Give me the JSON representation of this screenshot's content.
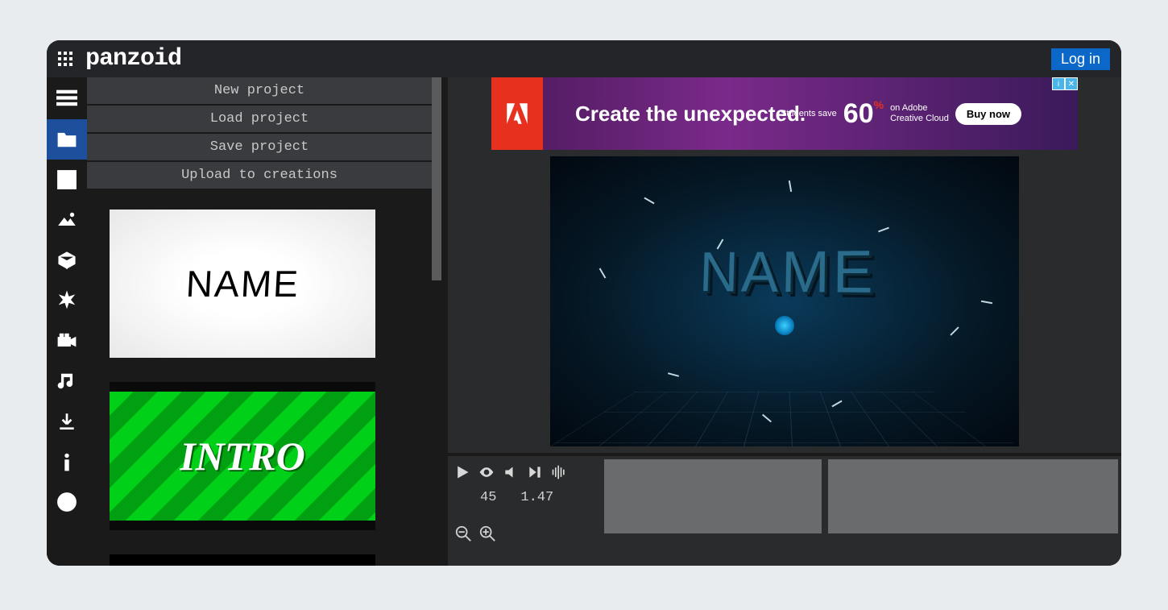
{
  "brand": "panzoid",
  "login": "Log in",
  "menu": {
    "new_project": "New project",
    "load_project": "Load project",
    "save_project": "Save project",
    "upload": "Upload to creations"
  },
  "thumbs": {
    "name_text": "NAME",
    "intro_text": "INTRO"
  },
  "ad": {
    "headline": "Create the unexpected.",
    "students": "Students save",
    "percent": "60",
    "pct_sym": "%",
    "sub1": "on Adobe",
    "sub2": "Creative Cloud",
    "buy": "Buy now",
    "info": "i",
    "close": "✕"
  },
  "preview": {
    "text_3d": "NAME"
  },
  "timeline": {
    "frame": "45",
    "time": "1.47"
  }
}
